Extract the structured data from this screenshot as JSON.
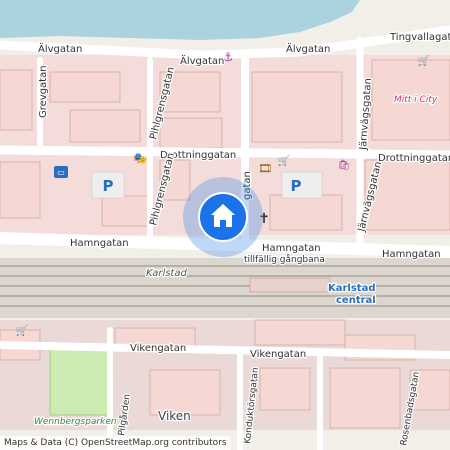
{
  "streets": {
    "alvgatan_a": "Älvgatan",
    "alvgatan_b": "Älvgatan",
    "alvgatan_c": "Älvgatan",
    "tingvallagatan": "Tingvallagatan",
    "drottninggatan_a": "Drottninggatan",
    "drottninggatan_b": "Drottninggatan",
    "hamngatan_a": "Hamngatan",
    "hamngatan_b": "Hamngatan",
    "hamngatan_c": "Hamngatan",
    "vikengatan_a": "Vikengatan",
    "vikengatan_b": "Vikengatan",
    "grevgatan": "Grevgatan",
    "pihlgrensgatan_a": "Pihlgrensgatan",
    "pihlgrensgatan_b": "Pihlgrensgatan",
    "jarnvagsgatan_a": "Järnvägsgatan",
    "jarnvagsgatan_b": "Järnvägsgatan",
    "lagatan": "gatan",
    "pilgarden": "Pilgården",
    "konduktorsgatan": "Konduktörsgatan",
    "rosenbadsgatan": "Rosenbadsgatan",
    "tillfallig": "tillfällig gångbana"
  },
  "places": {
    "karlstad_italic": "Karlstad",
    "station_line1": "Karlstad",
    "station_line2": "central",
    "mitt_i_city": "Mitt i City",
    "wennbergsparken": "Wennbergsparken",
    "viken": "Viken"
  },
  "symbols": {
    "parking": "P"
  },
  "credit": "Maps & Data (C) OpenStreetMap.org contributors",
  "colors": {
    "water": "#aad3df",
    "building": "#f5d7d3",
    "building_stroke": "#d6a9a3",
    "road": "#ffffff",
    "railway": "#b9b3ac",
    "park": "#cdebb0",
    "marker": "#1a73e8",
    "marker_halo": "#4a8ee8"
  },
  "icons": [
    "home-icon",
    "parking-icon",
    "anchor-icon",
    "shop-icon",
    "theatre-icon",
    "cinema-icon",
    "church-icon",
    "bus-icon"
  ]
}
